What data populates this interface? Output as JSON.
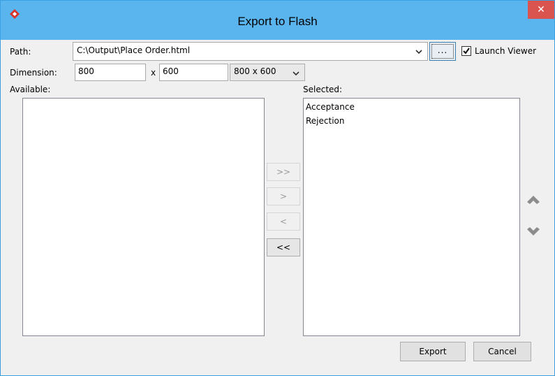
{
  "window": {
    "title": "Export to Flash",
    "close_glyph": "✕",
    "app_icon": "visual-paradigm-logo",
    "accent_color": "#5ab4ee"
  },
  "path": {
    "label": "Path:",
    "value": "C:\\Output\\Place Order.html",
    "browse_label": "...",
    "launch_viewer_label": "Launch Viewer",
    "launch_viewer_checked": true
  },
  "dimension": {
    "label": "Dimension:",
    "width": "800",
    "separator": "x",
    "height": "600",
    "preset": "800 x 600"
  },
  "available": {
    "label": "Available:",
    "items": []
  },
  "selected": {
    "label": "Selected:",
    "items": [
      "Acceptance",
      "Rejection"
    ]
  },
  "move_buttons": {
    "add_all": ">>",
    "add": ">",
    "remove": "<",
    "remove_all": "<<"
  },
  "footer": {
    "export_label": "Export",
    "cancel_label": "Cancel"
  }
}
